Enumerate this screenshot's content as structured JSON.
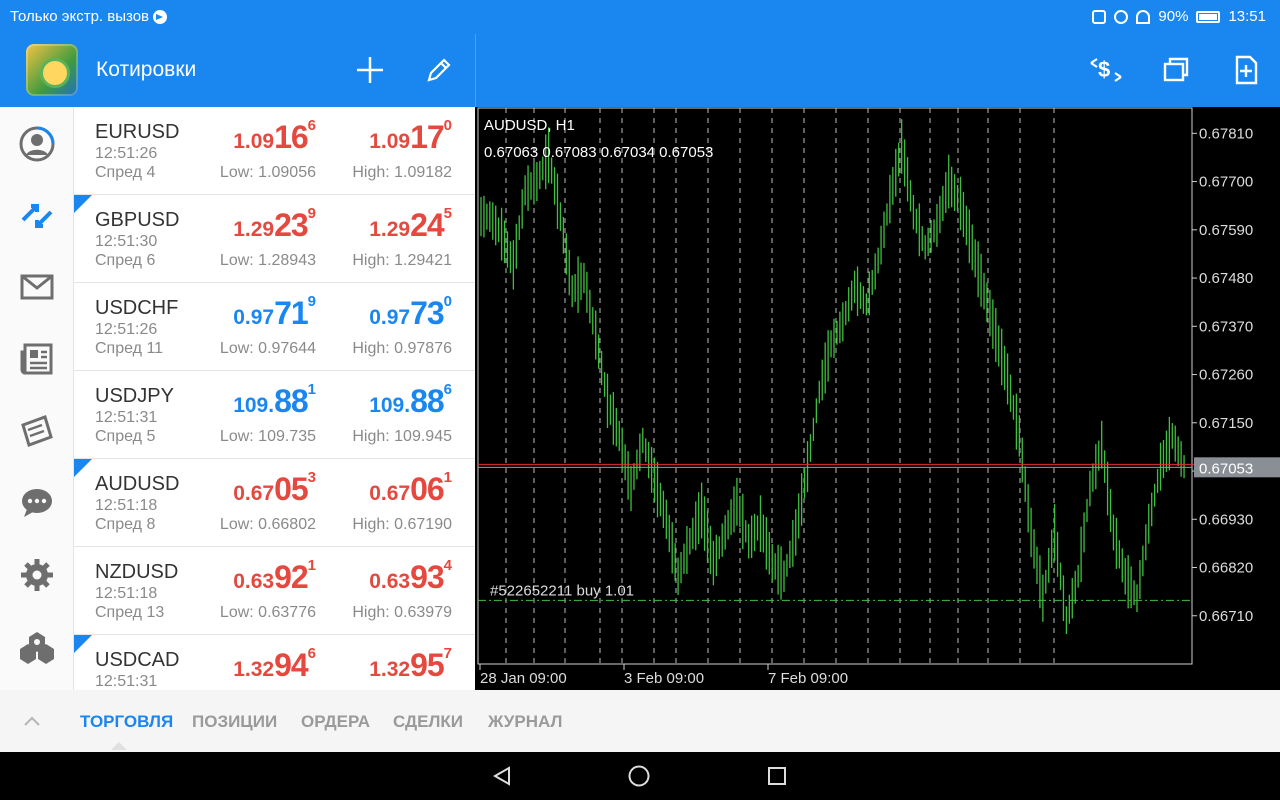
{
  "status_bar": {
    "left_text": "Только экстр. вызов",
    "battery": "90%",
    "time": "13:51"
  },
  "app_bar": {
    "title": "Котировки"
  },
  "colors": {
    "accent": "#1a86f0",
    "down": "#e5483e",
    "up": "#1a86f0",
    "candle": "#3fbf3f"
  },
  "quotes": [
    {
      "symbol": "EURUSD",
      "time": "12:51:26",
      "spread": "Спред 4",
      "dir": "red",
      "flag": false,
      "bid": {
        "a": "1.09",
        "b": "16",
        "c": "6"
      },
      "ask": {
        "a": "1.09",
        "b": "17",
        "c": "0"
      },
      "low": "Low: 1.09056",
      "high": "High: 1.09182"
    },
    {
      "symbol": "GBPUSD",
      "time": "12:51:30",
      "spread": "Спред 6",
      "dir": "red",
      "flag": true,
      "bid": {
        "a": "1.29",
        "b": "23",
        "c": "9"
      },
      "ask": {
        "a": "1.29",
        "b": "24",
        "c": "5"
      },
      "low": "Low: 1.28943",
      "high": "High: 1.29421"
    },
    {
      "symbol": "USDCHF",
      "time": "12:51:26",
      "spread": "Спред 11",
      "dir": "blue",
      "flag": false,
      "bid": {
        "a": "0.97",
        "b": "71",
        "c": "9"
      },
      "ask": {
        "a": "0.97",
        "b": "73",
        "c": "0"
      },
      "low": "Low: 0.97644",
      "high": "High: 0.97876"
    },
    {
      "symbol": "USDJPY",
      "time": "12:51:31",
      "spread": "Спред 5",
      "dir": "blue",
      "flag": false,
      "bid": {
        "a": "109.",
        "b": "88",
        "c": "1"
      },
      "ask": {
        "a": "109.",
        "b": "88",
        "c": "6"
      },
      "low": "Low: 109.735",
      "high": "High: 109.945"
    },
    {
      "symbol": "AUDUSD",
      "time": "12:51:18",
      "spread": "Спред 8",
      "dir": "red",
      "flag": true,
      "bid": {
        "a": "0.67",
        "b": "05",
        "c": "3"
      },
      "ask": {
        "a": "0.67",
        "b": "06",
        "c": "1"
      },
      "low": "Low: 0.66802",
      "high": "High: 0.67190"
    },
    {
      "symbol": "NZDUSD",
      "time": "12:51:18",
      "spread": "Спред 13",
      "dir": "red",
      "flag": false,
      "bid": {
        "a": "0.63",
        "b": "92",
        "c": "1"
      },
      "ask": {
        "a": "0.63",
        "b": "93",
        "c": "4"
      },
      "low": "Low: 0.63776",
      "high": "High: 0.63979"
    },
    {
      "symbol": "USDCAD",
      "time": "12:51:31",
      "spread": "",
      "dir": "red",
      "flag": true,
      "bid": {
        "a": "1.32",
        "b": "94",
        "c": "6"
      },
      "ask": {
        "a": "1.32",
        "b": "95",
        "c": "7"
      },
      "low": "",
      "high": ""
    }
  ],
  "chart": {
    "symbol_label": "AUDUSD, H1",
    "ohlc_label": "0.67063 0.67083 0.67034 0.67053",
    "y_ticks": [
      "0.67810",
      "0.67700",
      "0.67590",
      "0.67480",
      "0.67370",
      "0.67260",
      "0.67150",
      "0.67040",
      "0.66930",
      "0.66820",
      "0.66710"
    ],
    "x_ticks": [
      "28 Jan 09:00",
      "3 Feb 09:00",
      "7 Feb 09:00"
    ],
    "current_price": "0.67053",
    "order_label": "#522652211 buy 1.01"
  },
  "chart_data": {
    "type": "bar",
    "title": "AUDUSD, H1",
    "ylim": [
      0.666,
      0.6787
    ],
    "y_ticks": [
      0.6781,
      0.677,
      0.6759,
      0.6748,
      0.6737,
      0.6726,
      0.6715,
      0.6704,
      0.6693,
      0.6682,
      0.6671
    ],
    "x_ticks": [
      "28 Jan 09:00",
      "3 Feb 09:00",
      "7 Feb 09:00"
    ],
    "current_price": 0.67053,
    "order_price": 0.66745,
    "close_series": [
      0.6762,
      0.6758,
      0.6751,
      0.6768,
      0.677,
      0.6776,
      0.6762,
      0.6745,
      0.6748,
      0.6735,
      0.672,
      0.6712,
      0.67,
      0.6711,
      0.6702,
      0.6693,
      0.668,
      0.6688,
      0.6695,
      0.6683,
      0.669,
      0.6697,
      0.6688,
      0.6692,
      0.6683,
      0.668,
      0.669,
      0.6705,
      0.6722,
      0.6733,
      0.6738,
      0.6746,
      0.6742,
      0.6752,
      0.6766,
      0.6778,
      0.6763,
      0.6755,
      0.676,
      0.677,
      0.6765,
      0.6755,
      0.6745,
      0.6735,
      0.6725,
      0.6712,
      0.669,
      0.6675,
      0.669,
      0.667,
      0.668,
      0.67,
      0.671,
      0.669,
      0.668,
      0.6675,
      0.6692,
      0.6705,
      0.6712,
      0.6705
    ]
  },
  "tabs": [
    "ТОРГОВЛЯ",
    "ПОЗИЦИИ",
    "ОРДЕРА",
    "СДЕЛКИ",
    "ЖУРНАЛ"
  ]
}
